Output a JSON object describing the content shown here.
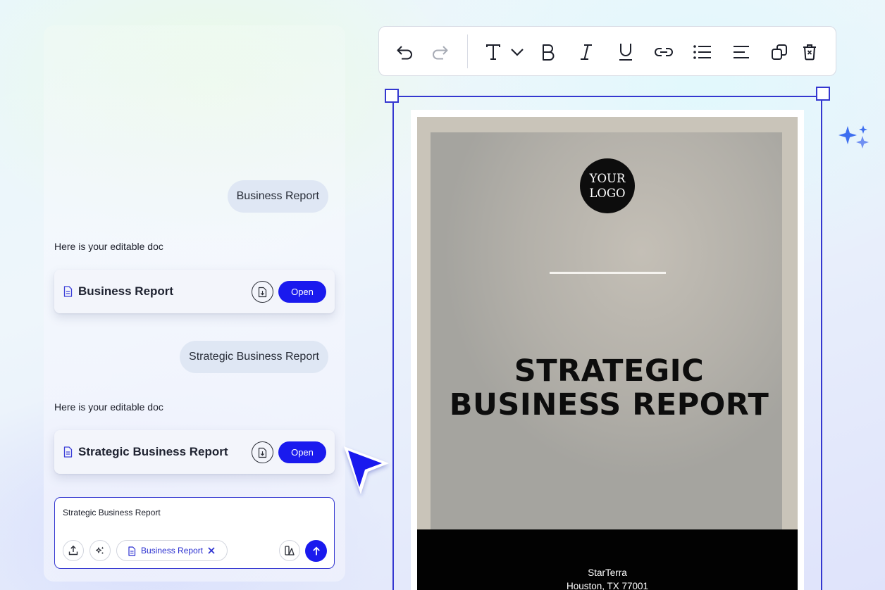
{
  "chat": {
    "messages": [
      {
        "role": "user",
        "text": "Business Report"
      },
      {
        "role": "assistant",
        "text": "Here is your editable doc"
      },
      {
        "role": "user",
        "text": "Strategic Business Report"
      },
      {
        "role": "assistant",
        "text": "Here is your editable doc"
      }
    ],
    "doc_cards": [
      {
        "title": "Business Report",
        "open_label": "Open"
      },
      {
        "title": "Strategic Business Report",
        "open_label": "Open"
      }
    ],
    "composer": {
      "text": "Strategic Business Report",
      "chip_label": "Business Report"
    }
  },
  "toolbar": {
    "icons": [
      "undo-icon",
      "redo-icon",
      "text-icon",
      "chevron-down-icon",
      "bold-icon",
      "italic-icon",
      "underline-icon",
      "link-icon",
      "bulleted-list-icon",
      "align-left-icon",
      "duplicate-icon",
      "delete-icon"
    ]
  },
  "document": {
    "logo_line1": "YOUR",
    "logo_line2": "LOGO",
    "title_line1": "STRATEGIC",
    "title_line2": "BUSINESS REPORT",
    "company": "StarTerra",
    "address": "Houston, TX 77001"
  },
  "colors": {
    "accent": "#1a1aee",
    "selection": "#3437d0",
    "cover": "#c9c4b9",
    "footer": "#020202"
  }
}
